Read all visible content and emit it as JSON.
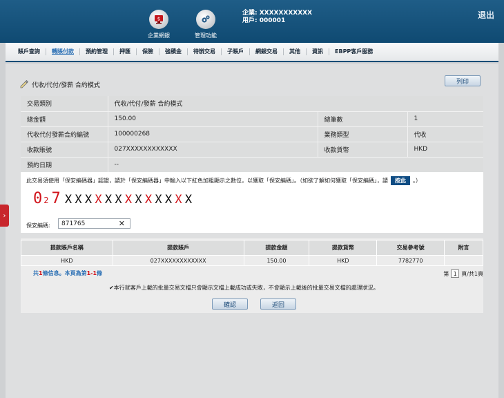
{
  "header": {
    "enterprise_label": "企業網銀",
    "management_label": "管理功能",
    "company_line": "企業: XXXXXXXXXXX",
    "user_line": "用戶: 000001",
    "logout": "退出"
  },
  "menu": [
    {
      "label": "賬戶查詢",
      "active": false
    },
    {
      "label": "轉賬付款",
      "active": true
    },
    {
      "label": "預約管理",
      "active": false
    },
    {
      "label": "押匯",
      "active": false
    },
    {
      "label": "保險",
      "active": false
    },
    {
      "label": "強積金",
      "active": false
    },
    {
      "label": "待辦交易",
      "active": false
    },
    {
      "label": "子賬戶",
      "active": false
    },
    {
      "label": "網銀交易",
      "active": false
    },
    {
      "label": "其他",
      "active": false
    },
    {
      "label": "資訊",
      "active": false
    },
    {
      "label": "EBPP客戶服務",
      "active": false
    }
  ],
  "page": {
    "title": "代收/代付/發薪 合約模式",
    "print_button": "列印"
  },
  "info": {
    "txn_type_label": "交易類別",
    "txn_type_value": "代收/代付/發薪 合約模式",
    "total_amount_label": "總金額",
    "total_amount_value": "150.00",
    "total_count_label": "總筆數",
    "total_count_value": "1",
    "contract_no_label": "代收代付發薪合約編號",
    "contract_no_value": "100000268",
    "business_type_label": "業務類型",
    "business_type_value": "代收",
    "account_label": "收款賬號",
    "account_value": "027XXXXXXXXXXXX",
    "currency_label": "收款貨幣",
    "currency_value": "HKD",
    "appt_date_label": "預約日期",
    "appt_date_value": "--"
  },
  "security": {
    "instruction": "此交易須使用「保安編碼器」認證，請於「保安編碼器」中輸入以下紅色加粗顯示之數位，以獲取「保安編碼」。（如欲了解如何獲取「保安編碼」，請",
    "here_button": "按此",
    "instruction_end": "。）",
    "code_prefix_digit1": "0",
    "code_prefix_sub": "2",
    "code_prefix_digit2": "7",
    "code_chars": [
      "X",
      "X",
      "X",
      "X",
      "X",
      "X",
      "X",
      "X",
      "X",
      "X",
      "X",
      "X",
      "X"
    ],
    "code_red_positions": [
      3,
      6,
      8,
      11
    ],
    "input_label": "保安編碼:",
    "input_value": "871765",
    "clear_icon": "✕"
  },
  "transactions": {
    "headers": [
      "提款賬戶名稱",
      "提款賬戶",
      "提款金額",
      "提款貨幣",
      "交易參考號",
      "附言"
    ],
    "rows": [
      [
        "HKD",
        "027XXXXXXXXXXXX",
        "150.00",
        "HKD",
        "7782770",
        ""
      ]
    ],
    "summary_prefix": "共",
    "summary_count": "1",
    "summary_mid": "條信息。本頁為第",
    "summary_range": "1-1",
    "summary_suffix": "條",
    "page_prefix": "第",
    "page_number": "1",
    "page_suffix": "頁/共1頁",
    "note": "本行就客戶上載的批量交易文檔只會顯示文檔上載成功或失敗，不會顯示上載後的批量交易文檔的處理狀況。",
    "confirm_button": "確認",
    "back_button": "返回"
  },
  "colors": {
    "header_blue": "#0f4a72",
    "accent_red": "#d1131a",
    "link_blue": "#2a6fb4"
  }
}
